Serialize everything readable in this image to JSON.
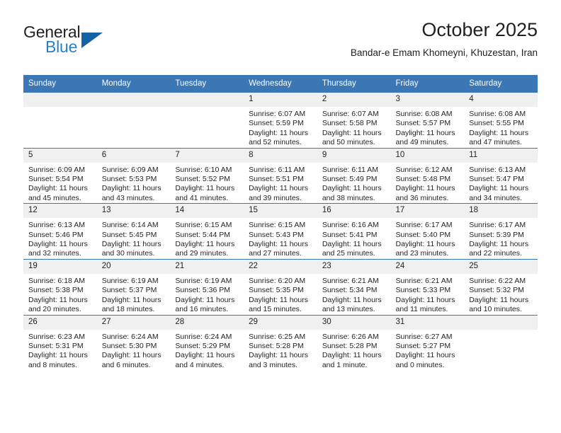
{
  "brand": {
    "name_primary": "General",
    "name_secondary": "Blue",
    "triangle_icon": "triangle-icon",
    "primary_color": "#231f20",
    "secondary_color": "#2a7fc9",
    "triangle_color": "#1463a5"
  },
  "header": {
    "title": "October 2025",
    "subtitle": "Bandar-e Emam Khomeyni, Khuzestan, Iran",
    "header_bg_color": "#3b76b5",
    "daynum_bg_color": "#f0f0f0"
  },
  "weekdays": [
    "Sunday",
    "Monday",
    "Tuesday",
    "Wednesday",
    "Thursday",
    "Friday",
    "Saturday"
  ],
  "labels": {
    "sunrise": "Sunrise:",
    "sunset": "Sunset:",
    "daylight": "Daylight:"
  },
  "weeks": [
    [
      {
        "day": "",
        "blank": true
      },
      {
        "day": "",
        "blank": true
      },
      {
        "day": "",
        "blank": true
      },
      {
        "day": "1",
        "sunrise": "Sunrise: 6:07 AM",
        "sunset": "Sunset: 5:59 PM",
        "daylight_line1": "Daylight: 11 hours",
        "daylight_line2": "and 52 minutes."
      },
      {
        "day": "2",
        "sunrise": "Sunrise: 6:07 AM",
        "sunset": "Sunset: 5:58 PM",
        "daylight_line1": "Daylight: 11 hours",
        "daylight_line2": "and 50 minutes."
      },
      {
        "day": "3",
        "sunrise": "Sunrise: 6:08 AM",
        "sunset": "Sunset: 5:57 PM",
        "daylight_line1": "Daylight: 11 hours",
        "daylight_line2": "and 49 minutes."
      },
      {
        "day": "4",
        "sunrise": "Sunrise: 6:08 AM",
        "sunset": "Sunset: 5:55 PM",
        "daylight_line1": "Daylight: 11 hours",
        "daylight_line2": "and 47 minutes."
      }
    ],
    [
      {
        "day": "5",
        "sunrise": "Sunrise: 6:09 AM",
        "sunset": "Sunset: 5:54 PM",
        "daylight_line1": "Daylight: 11 hours",
        "daylight_line2": "and 45 minutes."
      },
      {
        "day": "6",
        "sunrise": "Sunrise: 6:09 AM",
        "sunset": "Sunset: 5:53 PM",
        "daylight_line1": "Daylight: 11 hours",
        "daylight_line2": "and 43 minutes."
      },
      {
        "day": "7",
        "sunrise": "Sunrise: 6:10 AM",
        "sunset": "Sunset: 5:52 PM",
        "daylight_line1": "Daylight: 11 hours",
        "daylight_line2": "and 41 minutes."
      },
      {
        "day": "8",
        "sunrise": "Sunrise: 6:11 AM",
        "sunset": "Sunset: 5:51 PM",
        "daylight_line1": "Daylight: 11 hours",
        "daylight_line2": "and 39 minutes."
      },
      {
        "day": "9",
        "sunrise": "Sunrise: 6:11 AM",
        "sunset": "Sunset: 5:49 PM",
        "daylight_line1": "Daylight: 11 hours",
        "daylight_line2": "and 38 minutes."
      },
      {
        "day": "10",
        "sunrise": "Sunrise: 6:12 AM",
        "sunset": "Sunset: 5:48 PM",
        "daylight_line1": "Daylight: 11 hours",
        "daylight_line2": "and 36 minutes."
      },
      {
        "day": "11",
        "sunrise": "Sunrise: 6:13 AM",
        "sunset": "Sunset: 5:47 PM",
        "daylight_line1": "Daylight: 11 hours",
        "daylight_line2": "and 34 minutes."
      }
    ],
    [
      {
        "day": "12",
        "sunrise": "Sunrise: 6:13 AM",
        "sunset": "Sunset: 5:46 PM",
        "daylight_line1": "Daylight: 11 hours",
        "daylight_line2": "and 32 minutes."
      },
      {
        "day": "13",
        "sunrise": "Sunrise: 6:14 AM",
        "sunset": "Sunset: 5:45 PM",
        "daylight_line1": "Daylight: 11 hours",
        "daylight_line2": "and 30 minutes."
      },
      {
        "day": "14",
        "sunrise": "Sunrise: 6:15 AM",
        "sunset": "Sunset: 5:44 PM",
        "daylight_line1": "Daylight: 11 hours",
        "daylight_line2": "and 29 minutes."
      },
      {
        "day": "15",
        "sunrise": "Sunrise: 6:15 AM",
        "sunset": "Sunset: 5:43 PM",
        "daylight_line1": "Daylight: 11 hours",
        "daylight_line2": "and 27 minutes."
      },
      {
        "day": "16",
        "sunrise": "Sunrise: 6:16 AM",
        "sunset": "Sunset: 5:41 PM",
        "daylight_line1": "Daylight: 11 hours",
        "daylight_line2": "and 25 minutes."
      },
      {
        "day": "17",
        "sunrise": "Sunrise: 6:17 AM",
        "sunset": "Sunset: 5:40 PM",
        "daylight_line1": "Daylight: 11 hours",
        "daylight_line2": "and 23 minutes."
      },
      {
        "day": "18",
        "sunrise": "Sunrise: 6:17 AM",
        "sunset": "Sunset: 5:39 PM",
        "daylight_line1": "Daylight: 11 hours",
        "daylight_line2": "and 22 minutes."
      }
    ],
    [
      {
        "day": "19",
        "sunrise": "Sunrise: 6:18 AM",
        "sunset": "Sunset: 5:38 PM",
        "daylight_line1": "Daylight: 11 hours",
        "daylight_line2": "and 20 minutes."
      },
      {
        "day": "20",
        "sunrise": "Sunrise: 6:19 AM",
        "sunset": "Sunset: 5:37 PM",
        "daylight_line1": "Daylight: 11 hours",
        "daylight_line2": "and 18 minutes."
      },
      {
        "day": "21",
        "sunrise": "Sunrise: 6:19 AM",
        "sunset": "Sunset: 5:36 PM",
        "daylight_line1": "Daylight: 11 hours",
        "daylight_line2": "and 16 minutes."
      },
      {
        "day": "22",
        "sunrise": "Sunrise: 6:20 AM",
        "sunset": "Sunset: 5:35 PM",
        "daylight_line1": "Daylight: 11 hours",
        "daylight_line2": "and 15 minutes."
      },
      {
        "day": "23",
        "sunrise": "Sunrise: 6:21 AM",
        "sunset": "Sunset: 5:34 PM",
        "daylight_line1": "Daylight: 11 hours",
        "daylight_line2": "and 13 minutes."
      },
      {
        "day": "24",
        "sunrise": "Sunrise: 6:21 AM",
        "sunset": "Sunset: 5:33 PM",
        "daylight_line1": "Daylight: 11 hours",
        "daylight_line2": "and 11 minutes."
      },
      {
        "day": "25",
        "sunrise": "Sunrise: 6:22 AM",
        "sunset": "Sunset: 5:32 PM",
        "daylight_line1": "Daylight: 11 hours",
        "daylight_line2": "and 10 minutes."
      }
    ],
    [
      {
        "day": "26",
        "sunrise": "Sunrise: 6:23 AM",
        "sunset": "Sunset: 5:31 PM",
        "daylight_line1": "Daylight: 11 hours",
        "daylight_line2": "and 8 minutes."
      },
      {
        "day": "27",
        "sunrise": "Sunrise: 6:24 AM",
        "sunset": "Sunset: 5:30 PM",
        "daylight_line1": "Daylight: 11 hours",
        "daylight_line2": "and 6 minutes."
      },
      {
        "day": "28",
        "sunrise": "Sunrise: 6:24 AM",
        "sunset": "Sunset: 5:29 PM",
        "daylight_line1": "Daylight: 11 hours",
        "daylight_line2": "and 4 minutes."
      },
      {
        "day": "29",
        "sunrise": "Sunrise: 6:25 AM",
        "sunset": "Sunset: 5:28 PM",
        "daylight_line1": "Daylight: 11 hours",
        "daylight_line2": "and 3 minutes."
      },
      {
        "day": "30",
        "sunrise": "Sunrise: 6:26 AM",
        "sunset": "Sunset: 5:28 PM",
        "daylight_line1": "Daylight: 11 hours",
        "daylight_line2": "and 1 minute."
      },
      {
        "day": "31",
        "sunrise": "Sunrise: 6:27 AM",
        "sunset": "Sunset: 5:27 PM",
        "daylight_line1": "Daylight: 11 hours",
        "daylight_line2": "and 0 minutes."
      },
      {
        "day": "",
        "blank": true
      }
    ]
  ]
}
